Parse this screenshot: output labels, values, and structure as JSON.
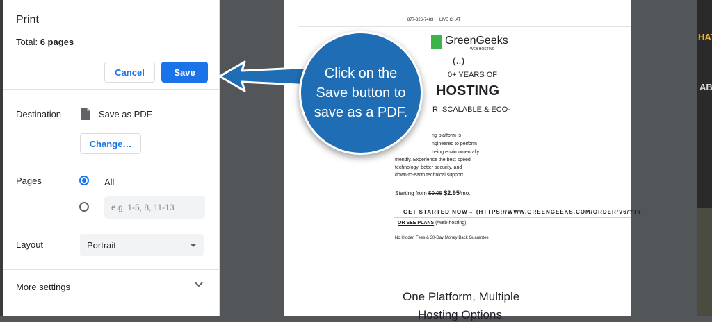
{
  "panel": {
    "title": "Print",
    "total_label": "Total:",
    "total_value": "6 pages",
    "cancel_label": "Cancel",
    "save_label": "Save",
    "destination_label": "Destination",
    "destination_value": "Save as PDF",
    "change_label": "Change…",
    "pages_label": "Pages",
    "pages_all": "All",
    "pages_placeholder": "e.g. 1-5, 8, 11-13",
    "layout_label": "Layout",
    "layout_value": "Portrait",
    "more_settings": "More settings"
  },
  "preview": {
    "phone": "877-326-7483 |",
    "live_chat": "LIVE CHAT",
    "logo_text": "GreenGeeks",
    "logo_sub": "WEB HOSTING",
    "dots": "(..)",
    "years": "0+ YEARS OF",
    "hosting": "HOSTING",
    "tagline": "R, SCALABLE & ECO-",
    "body1": "ng platform is",
    "body2": "ngineered to perform",
    "body3": "being environmentally",
    "body4": "friendly. Experience the best speed",
    "body5": "technology, better security, and",
    "body6": "down-to-earth technical support.",
    "starting_from": "Starting from",
    "old_price": "$9.95",
    "new_price": "$2.95",
    "per_mo": "/mo.",
    "get_started": "GET STARTED NOW→  (HTTPS://WWW.GREENGEEKS.COM/ORDER/V6/?TY",
    "or_see_plans": "OR SEE PLANS",
    "web_hosting_link": "(/web-hosting)",
    "guarantee": "No Hidden Fees & 30-Day Money Back Guarantee",
    "heading1": "One Platform, Multiple",
    "heading2": "Hosting Options"
  },
  "background": {
    "text1": "HAT",
    "text2": "AB"
  },
  "callout": {
    "text": "Click on the Save button to save as a PDF."
  },
  "colors": {
    "accent": "#1a73e8",
    "callout": "#1f6eb5",
    "brand_green": "#3cb44a"
  }
}
